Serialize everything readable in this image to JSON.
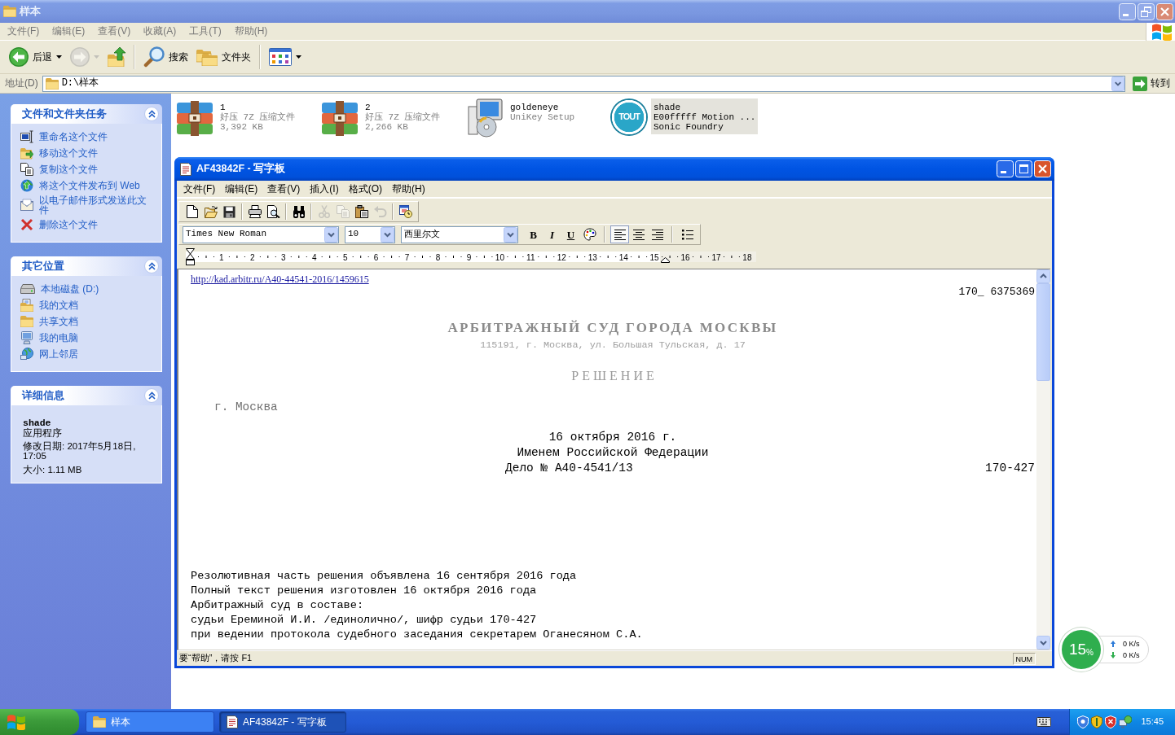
{
  "explorer": {
    "title": "样本",
    "active": false,
    "menu": [
      "文件(F)",
      "编辑(E)",
      "查看(V)",
      "收藏(A)",
      "工具(T)",
      "帮助(H)"
    ],
    "toolbar": [
      [
        {
          "kind": "back",
          "label": "后退",
          "dropdown": true,
          "disabled": false
        },
        {
          "kind": "forward",
          "dropdown": true,
          "disabled": true
        },
        {
          "kind": "up",
          "disabled": false
        }
      ],
      [
        {
          "kind": "search",
          "label": "搜索",
          "disabled": false
        },
        {
          "kind": "folders",
          "label": "文件夹",
          "disabled": false
        }
      ],
      [
        {
          "kind": "views",
          "dropdown": true,
          "disabled": false
        }
      ]
    ],
    "address": {
      "label": "地址(D)",
      "value": "D:\\样本",
      "go": "转到"
    },
    "task_panels": [
      {
        "title": "文件和文件夹任务",
        "expanded": true,
        "items": [
          {
            "kind": "rename",
            "label": "重命名这个文件"
          },
          {
            "kind": "move",
            "label": "移动这个文件"
          },
          {
            "kind": "copy",
            "label": "复制这个文件"
          },
          {
            "kind": "publish",
            "label": "将这个文件发布到 Web"
          },
          {
            "kind": "email",
            "label": "以电子邮件形式发送此文件"
          },
          {
            "kind": "delete",
            "label": "删除这个文件"
          }
        ]
      },
      {
        "title": "其它位置",
        "expanded": true,
        "items": [
          {
            "kind": "drive",
            "label": "本地磁盘 (D:)"
          },
          {
            "kind": "documents",
            "label": "我的文档"
          },
          {
            "kind": "shared",
            "label": "共享文档"
          },
          {
            "kind": "computer",
            "label": "我的电脑"
          },
          {
            "kind": "network",
            "label": "网上邻居"
          }
        ]
      },
      {
        "title": "详细信息",
        "expanded": true,
        "details": {
          "name": "shade",
          "type": "应用程序",
          "modified": "修改日期: 2017年5月18日, 17:05",
          "size": "大小: 1.11 MB"
        }
      }
    ],
    "files": [
      {
        "kind": "archive",
        "name": "1",
        "details": [
          "好压 7Z 压缩文件",
          "3,392 KB"
        ],
        "selected": false
      },
      {
        "kind": "archive",
        "name": "2",
        "details": [
          "好压 7Z 压缩文件",
          "2,266 KB"
        ],
        "selected": false
      },
      {
        "kind": "installer",
        "name": "goldeneye",
        "details": [
          "UniKey Setup"
        ],
        "selected": false
      },
      {
        "kind": "app",
        "name": "shade",
        "details": [
          "E00fffff Motion ...",
          "Sonic Foundry"
        ],
        "icon_text": "TOUT",
        "selected": true
      }
    ]
  },
  "wordpad": {
    "title": "AF43842F - 写字板",
    "active": true,
    "menu": [
      "文件(F)",
      "编辑(E)",
      "查看(V)",
      "插入(I)",
      "格式(O)",
      "帮助(H)"
    ],
    "toolbar": [
      [
        {
          "kind": "new",
          "disabled": false
        },
        {
          "kind": "open",
          "disabled": false
        },
        {
          "kind": "save",
          "disabled": false
        }
      ],
      [
        {
          "kind": "print",
          "disabled": false
        },
        {
          "kind": "preview",
          "disabled": false
        }
      ],
      [
        {
          "kind": "find",
          "disabled": false
        }
      ],
      [
        {
          "kind": "cut",
          "disabled": true
        },
        {
          "kind": "copy",
          "disabled": true
        },
        {
          "kind": "paste",
          "disabled": false
        },
        {
          "kind": "undo",
          "disabled": true
        }
      ],
      [
        {
          "kind": "datetime",
          "disabled": false
        }
      ]
    ],
    "format": {
      "font": "Times New Roman",
      "size": "10",
      "script": "西里尔文",
      "styles": [
        {
          "kind": "bold",
          "glyph": "B"
        },
        {
          "kind": "italic",
          "glyph": "I"
        },
        {
          "kind": "underline",
          "glyph": "U"
        },
        {
          "kind": "color"
        }
      ],
      "align": [
        {
          "kind": "left",
          "selected": true
        },
        {
          "kind": "center",
          "selected": false
        },
        {
          "kind": "right",
          "selected": false
        }
      ],
      "paragraph": [
        {
          "kind": "bullets",
          "selected": false
        }
      ]
    },
    "ruler": {
      "marks": [
        "1",
        "2",
        "3",
        "4",
        "5",
        "6",
        "7",
        "8",
        "9",
        "10",
        "11",
        "12",
        "13",
        "14",
        "15",
        "16",
        "17",
        "18"
      ]
    },
    "document": {
      "header": [
        {
          "kind": "link",
          "text": "http://kad.arbitr.ru/A40-44541-2016/1459615"
        },
        {
          "kind": "right",
          "text": "170_ 6375369"
        },
        {
          "kind": "court",
          "text": "АРБИТРАЖНЫЙ СУД ГОРОДА МОСКВЫ"
        },
        {
          "kind": "address",
          "text": "115191, г. Москва, ул. Большая Тульская, д. 17"
        },
        {
          "kind": "decision",
          "text": "Р Е Ш Е Н И Е"
        },
        {
          "kind": "place",
          "text": "г. Москва"
        },
        {
          "kind": "center",
          "text": "16 октября 2016 г."
        },
        {
          "kind": "center",
          "text": "Именем Российской Федерации"
        },
        {
          "kind": "case",
          "text": "Дело № А40-4541/13",
          "right": "170-427"
        }
      ],
      "body": [
        "Резолютивная часть решения объявлена 16 сентября 2016 года",
        "Полный текст решения изготовлен 16 октября 2016 года",
        "Арбитражный суд в составе:",
        "судьи Ереминой И.И. /единолично/, шифр судьи 170-427",
        "при ведении протокола судебного заседания секретарем Оганесяном С.А."
      ]
    },
    "status": {
      "hint": "要“帮助”，请按 F1",
      "indicator": "NUM"
    }
  },
  "net_monitor": {
    "value": "15",
    "unit": "%",
    "up": "0 K/s",
    "down": "0 K/s"
  },
  "taskbar": {
    "tasks": [
      {
        "kind": "folder",
        "label": "样本",
        "selected": false
      },
      {
        "kind": "document",
        "label": "AF43842F - 写字板",
        "selected": true
      }
    ],
    "clock": "15:45"
  }
}
